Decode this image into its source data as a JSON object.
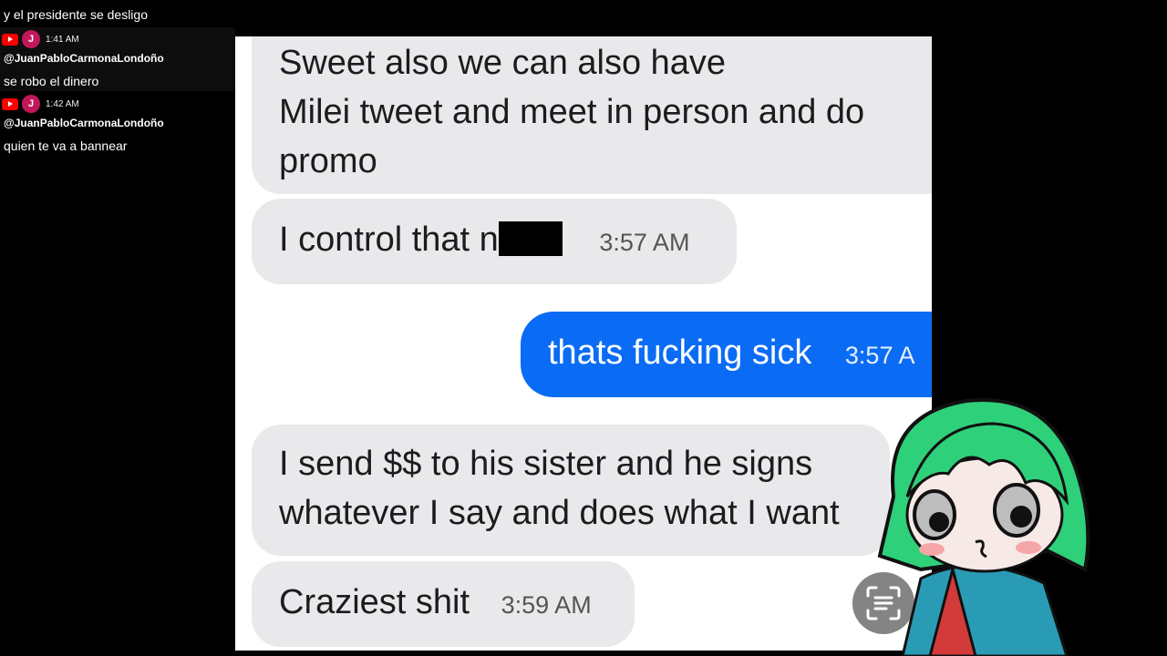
{
  "chat": {
    "top_message": "y el presidente se desligo",
    "messages": [
      {
        "avatar_letter": "J",
        "time": "1:41 AM",
        "user": "@JuanPabloCarmonaLondoño",
        "text": "se robo el dinero"
      },
      {
        "avatar_letter": "J",
        "time": "1:42 AM",
        "user": "@JuanPabloCarmonaLondoño",
        "text": "quien te va a bannear"
      }
    ]
  },
  "conversation": {
    "msg1_line1": "Sweet also we can also have",
    "msg1_line2": "Milei tweet and meet in person and do",
    "msg1_line3": "promo",
    "msg2_text": "I control that n",
    "msg2_time": "3:57 AM",
    "msg3_text": "thats fucking sick",
    "msg3_time": "3:57 A",
    "msg4_line1": "I send $$ to his sister and he signs",
    "msg4_line2": "whatever I say and does what I want",
    "msg5_text": "Craziest shit",
    "msg5_time": "3:59 AM"
  },
  "colors": {
    "received_bubble": "#e9e9eb",
    "sent_bubble": "#0a6cf5",
    "youtube_red": "#ff0000",
    "avatar_pink": "#c2185b",
    "character_hair": "#2fd07a"
  },
  "icons": [
    "youtube-icon",
    "scan-text-icon"
  ]
}
